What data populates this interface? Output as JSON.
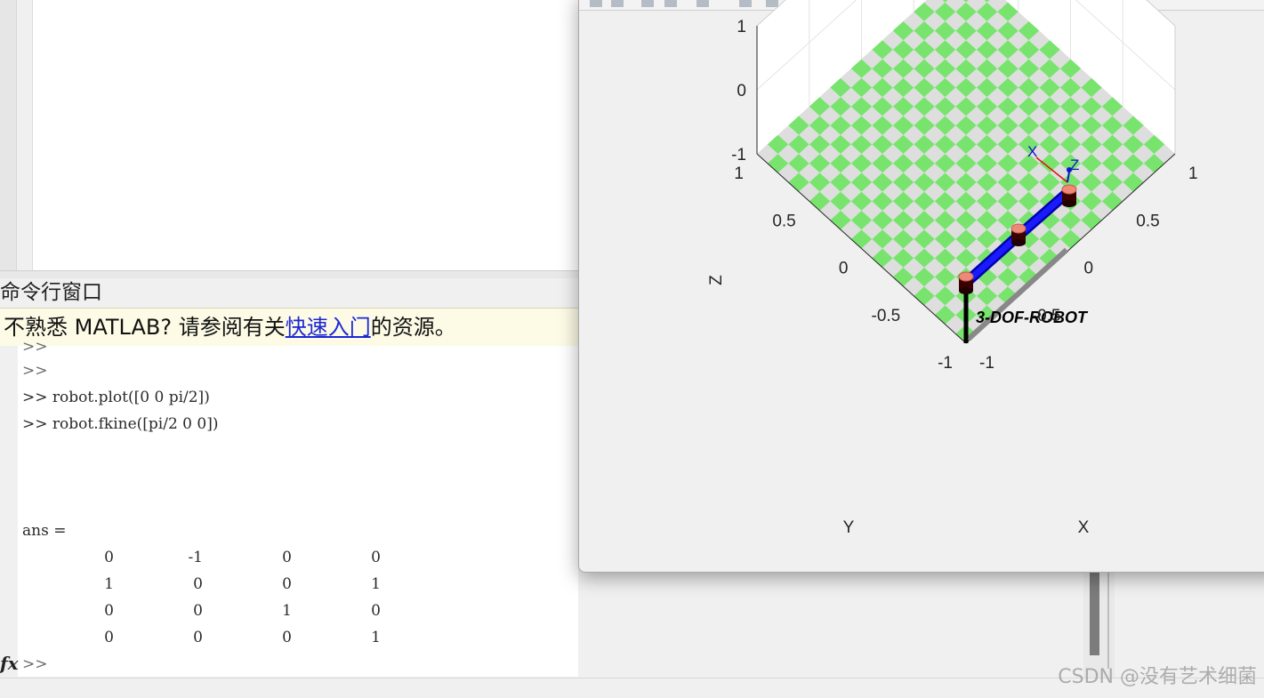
{
  "command_window": {
    "title": "命令行窗口",
    "notice": {
      "prefix": "不熟悉 MATLAB? 请参阅有关",
      "link": "快速入门",
      "suffix": "的资源。"
    },
    "prompt": ">>",
    "history": [
      ">>",
      ">>",
      ">> robot.plot([0 0 pi/2])",
      ">> robot.fkine([pi/2 0 0])"
    ],
    "ans_label": "ans =",
    "matrix": [
      [
        "0",
        "-1",
        "0",
        "0"
      ],
      [
        "1",
        "0",
        "0",
        "1"
      ],
      [
        "0",
        "0",
        "1",
        "0"
      ],
      [
        "0",
        "0",
        "0",
        "1"
      ]
    ],
    "fx_icon": "fx",
    "fx_prompt": ">>"
  },
  "figure": {
    "robot_name": "3-DOF-ROBOT",
    "axes": {
      "z_label": "Z",
      "y_label": "Y",
      "x_label": "X",
      "z_ticks": [
        "1",
        "0",
        "-1"
      ],
      "y_ticks": [
        "1",
        "0.5",
        "0",
        "-0.5",
        "-1"
      ],
      "x_ticks": [
        "1",
        "0.5",
        "0",
        "-0.5",
        "-1"
      ]
    },
    "frame_labels": {
      "x": "X",
      "z": "Z"
    },
    "colors": {
      "floor_green": "#78e46e",
      "floor_gray": "#dedede",
      "link_blue": "#1a1aff",
      "joint_salmon": "#f08878",
      "shadow_gray": "#888888",
      "frame_x": "#e01010",
      "frame_z": "#1010d0"
    },
    "toolbar_icons": [
      "data-cursor-icon",
      "pan-icon",
      "zoom-in-icon",
      "zoom-out-icon",
      "rotate-icon",
      "save-icon",
      "print-icon",
      "home-icon"
    ]
  },
  "watermark": "CSDN @没有艺术细菌"
}
